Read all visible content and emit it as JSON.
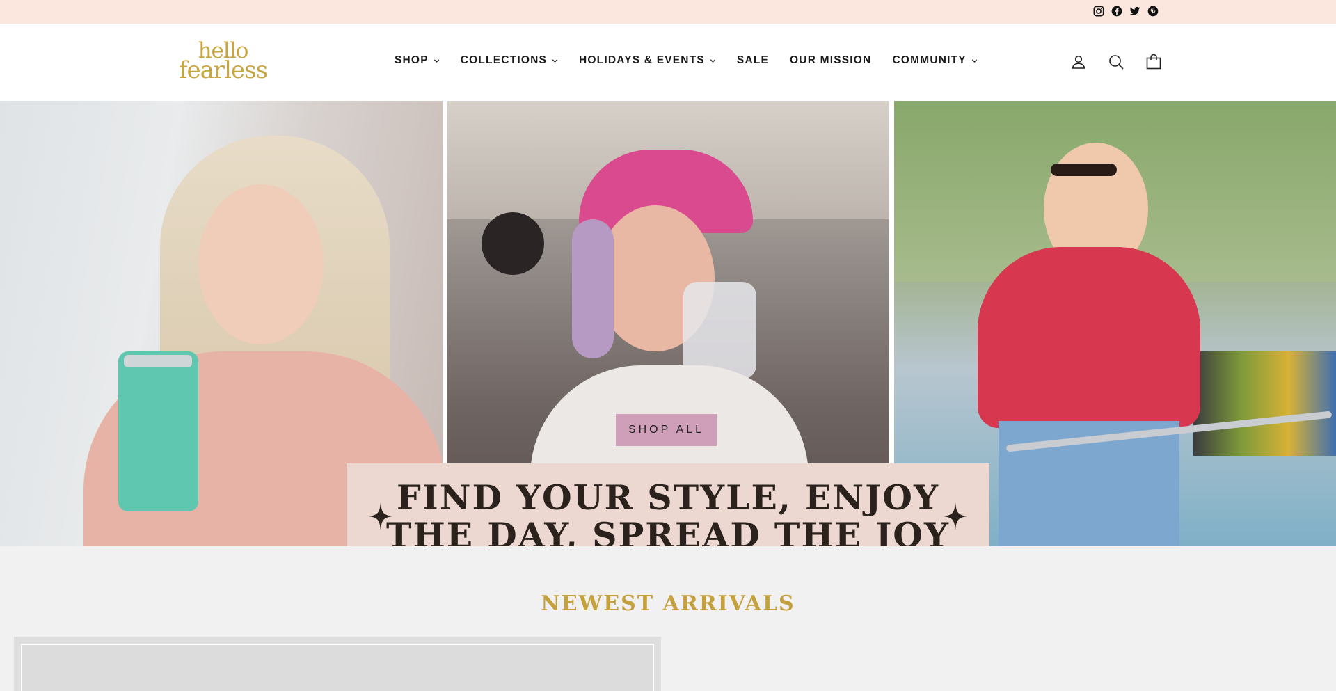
{
  "social": {
    "icons": [
      "instagram-icon",
      "facebook-icon",
      "twitter-icon",
      "pinterest-icon"
    ]
  },
  "brand": {
    "logo_line1": "hello",
    "logo_line2": "fearless",
    "accent_color": "#c9a53f"
  },
  "nav": {
    "items": [
      {
        "label": "SHOP",
        "has_dropdown": true
      },
      {
        "label": "COLLECTIONS",
        "has_dropdown": true
      },
      {
        "label": "HOLIDAYS & EVENTS",
        "has_dropdown": true
      },
      {
        "label": "SALE",
        "has_dropdown": false
      },
      {
        "label": "OUR MISSION",
        "has_dropdown": false
      },
      {
        "label": "COMMUNITY",
        "has_dropdown": true
      }
    ]
  },
  "header_icons": [
    "user-icon",
    "search-icon",
    "cart-icon"
  ],
  "hero": {
    "cta_label": "SHOP ALL",
    "banner_line1": "FIND YOUR STYLE, ENJOY",
    "banner_line2": "THE DAY, SPREAD THE JOY",
    "cta_color": "#cf9fba",
    "banner_color": "#ecd8d0"
  },
  "arrivals": {
    "title": "NEWEST ARRIVALS"
  }
}
